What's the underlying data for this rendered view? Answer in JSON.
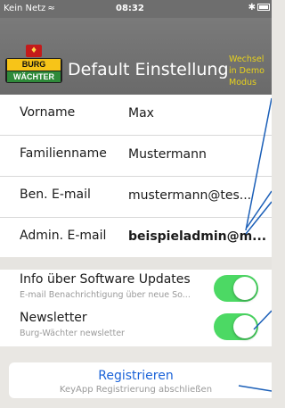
{
  "status_bar": {
    "carrier": "Kein Netz",
    "time": "08:32",
    "bluetooth": "✱"
  },
  "header": {
    "logo_top": "BURG",
    "logo_bottom": "WÄCHTER",
    "title": "Default Einstellung",
    "demo_note": [
      "Wechsel",
      "in Demo",
      "Modus"
    ]
  },
  "form": {
    "rows": [
      {
        "label": "Vorname",
        "value": "Max"
      },
      {
        "label": "Familienname",
        "value": "Mustermann"
      },
      {
        "label": "Ben. E-mail",
        "value": "mustermann@tes..."
      },
      {
        "label": "Admin. E-mail",
        "value": "beispieladmin@m..."
      }
    ]
  },
  "toggles": [
    {
      "label": "Info über Software Updates",
      "sub": "E-mail Benachrichtigung über neue So...",
      "on": true
    },
    {
      "label": "Newsletter",
      "sub": "Burg-Wächter newsletter",
      "on": true
    }
  ],
  "register": {
    "label": "Registrieren",
    "sub": "KeyApp Registrierung abschließen"
  },
  "colors": {
    "accent": "#1b63d8",
    "switch_on": "#4cd964",
    "header_bg": "#707070",
    "demo_note": "#e8d21c"
  }
}
